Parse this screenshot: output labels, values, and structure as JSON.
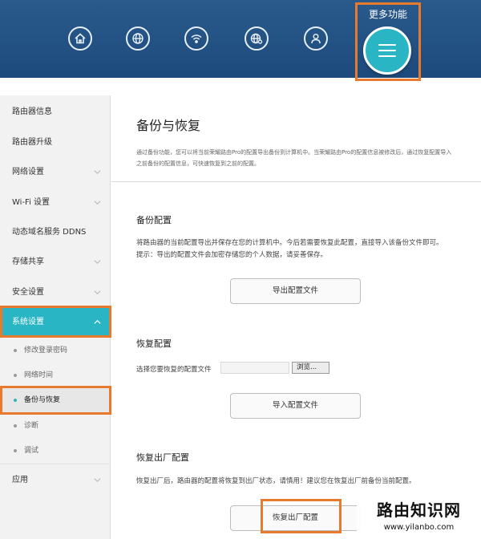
{
  "header": {
    "more_label": "更多功能",
    "nav_icons": [
      "home-icon",
      "globe-icon",
      "wifi-icon",
      "globe-settings-icon",
      "user-icon"
    ],
    "accent_color": "#29b5c4",
    "header_color": "#1d4a7c"
  },
  "sidebar": {
    "items": [
      {
        "label": "路由器信息"
      },
      {
        "label": "路由器升级"
      },
      {
        "label": "网络设置"
      },
      {
        "label": "Wi-Fi 设置"
      },
      {
        "label": "动态域名服务 DDNS"
      },
      {
        "label": "存储共享"
      },
      {
        "label": "安全设置"
      },
      {
        "label": "系统设置"
      },
      {
        "label": "应用"
      }
    ],
    "sub_items": [
      {
        "label": "修改登录密码"
      },
      {
        "label": "网络时间"
      },
      {
        "label": "备份与恢复"
      },
      {
        "label": "诊断"
      },
      {
        "label": "调试"
      }
    ]
  },
  "main": {
    "title": "备份与恢复",
    "description": "通过备份功能，您可以将当前荣耀路由Pro的配置导出备份到计算机中。当荣耀路由Pro的配置信息被修改后，通过恢复配置导入之前备份的配置信息，可快速恢复到之前的配置。",
    "backup": {
      "title": "备份配置",
      "text1": "将路由器的当前配置导出并保存在您的计算机中。今后若需要恢复此配置，直接导入该备份文件即可。",
      "text2": "提示：导出的配置文件会加密存储您的个人数据，请妥善保存。",
      "button": "导出配置文件"
    },
    "restore": {
      "title": "恢复配置",
      "file_label": "选择您要恢复的配置文件",
      "browse_button": "浏览...",
      "button": "导入配置文件"
    },
    "factory": {
      "title": "恢复出厂配置",
      "text": "恢复出厂后，路由器的配置将恢复到出厂状态，请慎用！建议您在恢复出厂前备份当前配置。",
      "button": "恢复出厂配置"
    }
  },
  "watermark": {
    "title": "路由知识网",
    "url": "www.yilanbo.com"
  }
}
